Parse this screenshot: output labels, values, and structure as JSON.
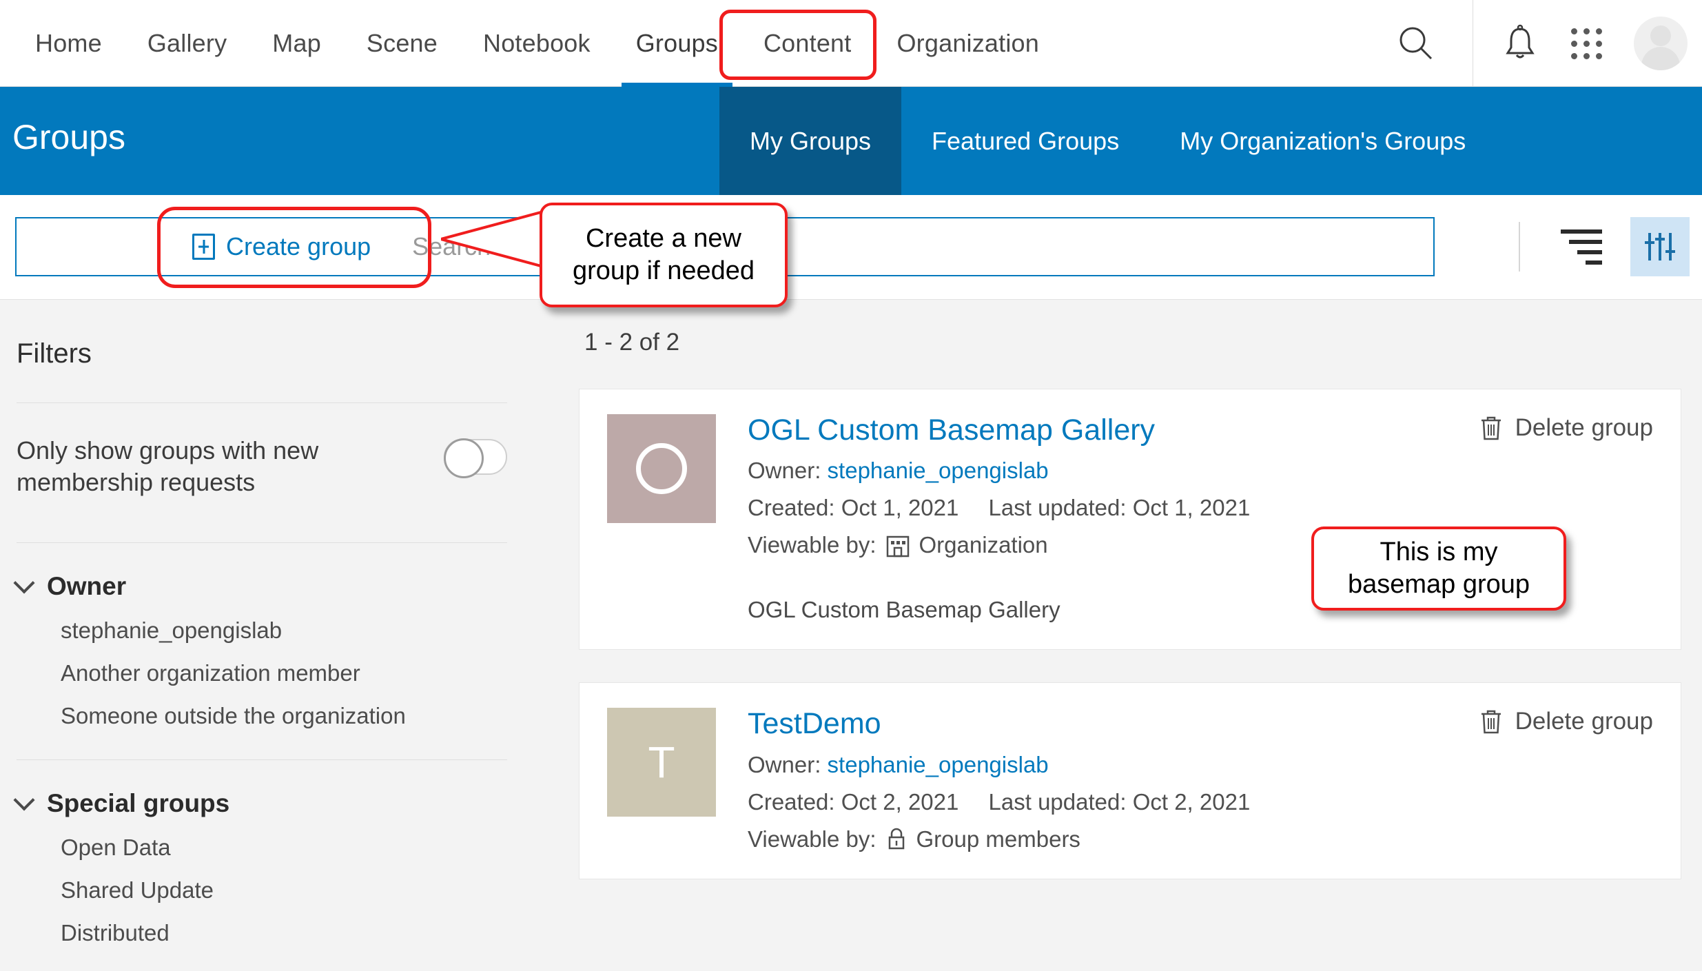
{
  "topnav": {
    "links": [
      {
        "label": "Home",
        "active": false
      },
      {
        "label": "Gallery",
        "active": false
      },
      {
        "label": "Map",
        "active": false
      },
      {
        "label": "Scene",
        "active": false
      },
      {
        "label": "Notebook",
        "active": false
      },
      {
        "label": "Groups",
        "active": true
      },
      {
        "label": "Content",
        "active": false
      },
      {
        "label": "Organization",
        "active": false
      }
    ],
    "search_icon": "search-icon",
    "notifications_icon": "bell-icon",
    "apps_icon": "app-grid-icon",
    "avatar_icon": "user-avatar"
  },
  "banner": {
    "title": "Groups",
    "accent_color": "#0279bd",
    "active_tab_color": "#075888",
    "tabs": [
      {
        "label": "My Groups",
        "active": true
      },
      {
        "label": "Featured Groups",
        "active": false
      },
      {
        "label": "My Organization's Groups",
        "active": false
      }
    ]
  },
  "toolbar": {
    "create_group_label": "Create group",
    "search_placeholder": "Search My Groups",
    "sort_icon": "sort-icon",
    "filter_toggle_icon": "filter-sliders-icon"
  },
  "sidebar": {
    "title": "Filters",
    "toggle_label": "Only show groups with new membership requests",
    "toggle_on": false,
    "facets": [
      {
        "title": "Owner",
        "items": [
          "stephanie_opengislab",
          "Another organization member",
          "Someone outside the organization"
        ]
      },
      {
        "title": "Special groups",
        "items": [
          "Open Data",
          "Shared Update",
          "Distributed"
        ]
      }
    ]
  },
  "results": {
    "count_label": "1 - 2 of 2",
    "delete_label": "Delete group",
    "owner_prefix": "Owner:",
    "created_prefix": "Created:",
    "updated_prefix": "Last updated:",
    "viewable_prefix": "Viewable by:",
    "cards": [
      {
        "title": "OGL Custom Basemap Gallery",
        "initial": "O",
        "thumb_color": "#bda9a8",
        "thumb_shape": "ring",
        "owner": "stephanie_opengislab",
        "created": "Oct 1, 2021",
        "updated": "Oct 1, 2021",
        "viewable": "Organization",
        "viewable_icon": "organization-building-icon",
        "description": "OGL Custom Basemap Gallery"
      },
      {
        "title": "TestDemo",
        "initial": "T",
        "thumb_color": "#cdc7b2",
        "thumb_shape": "letter",
        "owner": "stephanie_opengislab",
        "created": "Oct 2, 2021",
        "updated": "Oct 2, 2021",
        "viewable": "Group members",
        "viewable_icon": "lock-icon",
        "description": ""
      }
    ]
  },
  "annotations": {
    "highlight_color": "#f01d1d",
    "callout_create": "Create a new\ngroup if needed",
    "callout_create_line1": "Create a new",
    "callout_create_line2": "group if needed",
    "callout_basemap_line1": "This is my",
    "callout_basemap_line2": "basemap group"
  }
}
